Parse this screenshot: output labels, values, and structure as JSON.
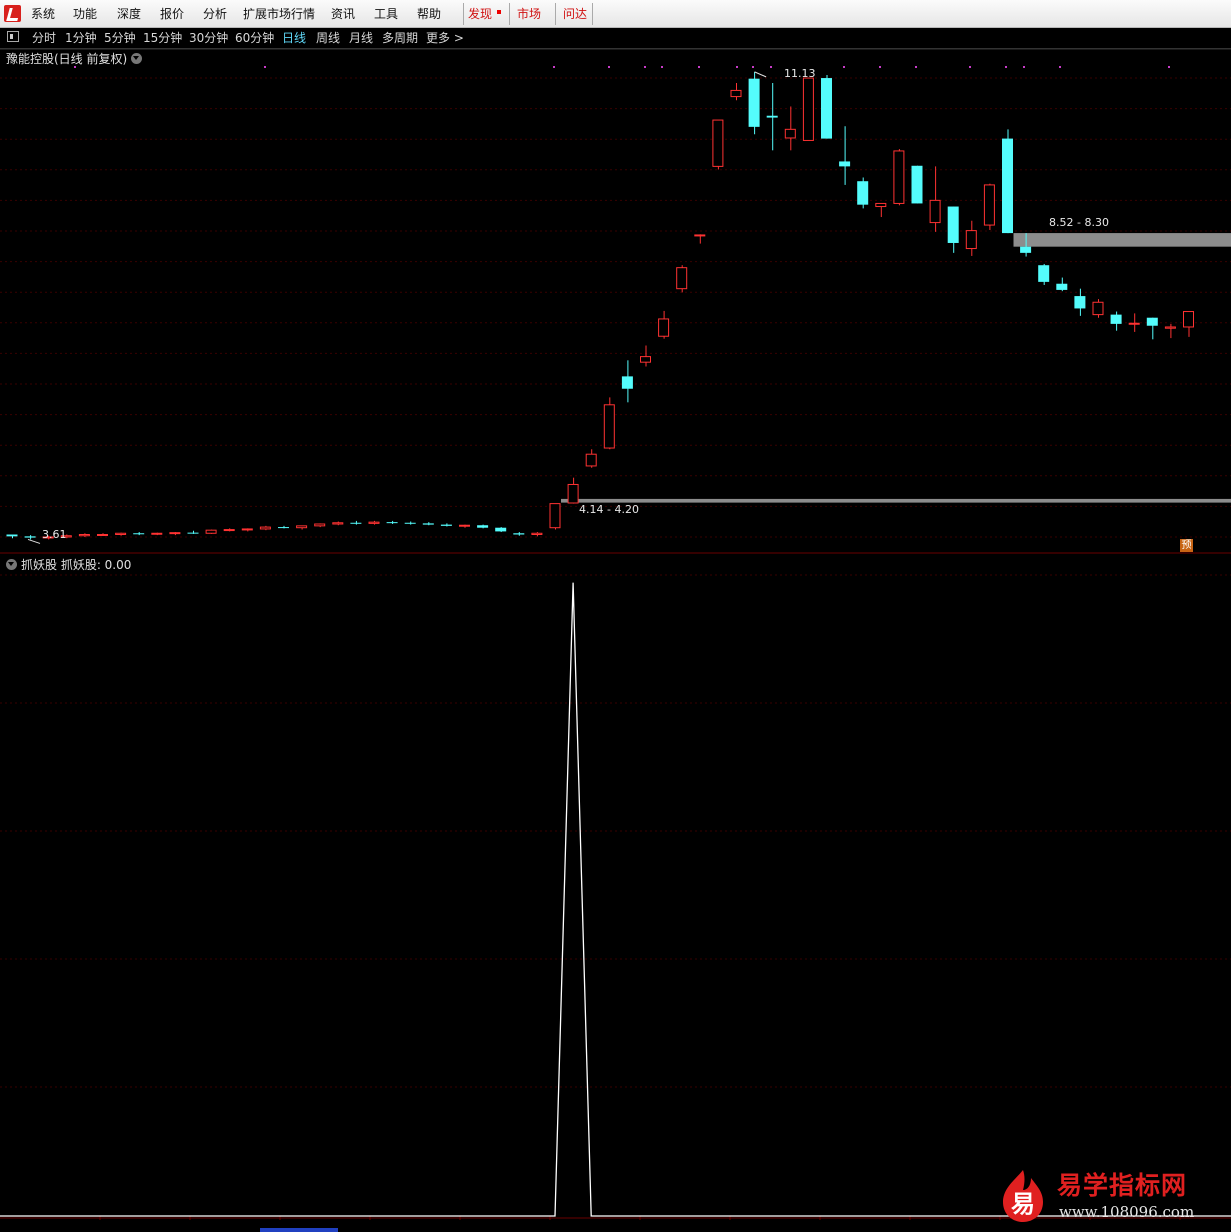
{
  "menu": {
    "items": [
      {
        "label": "系统"
      },
      {
        "label": "功能"
      },
      {
        "label": "深度"
      },
      {
        "label": "报价"
      },
      {
        "label": "分析"
      },
      {
        "label": "扩展市场行情"
      },
      {
        "label": "资讯"
      },
      {
        "label": "工具"
      },
      {
        "label": "帮助"
      }
    ],
    "discover": "发现",
    "market": "市场",
    "wenda": "问达"
  },
  "periods": {
    "items": [
      {
        "label": "分时"
      },
      {
        "label": "1分钟"
      },
      {
        "label": "5分钟"
      },
      {
        "label": "15分钟"
      },
      {
        "label": "30分钟"
      },
      {
        "label": "60分钟"
      },
      {
        "label": "日线"
      },
      {
        "label": "周线"
      },
      {
        "label": "月线"
      },
      {
        "label": "多周期"
      },
      {
        "label": "更多 >"
      }
    ],
    "active": "日线"
  },
  "stock": {
    "title": "豫能控股(日线 前复权)"
  },
  "labels": {
    "high": "11.13",
    "low": "3.61",
    "gap_low": "4.14 - 4.20",
    "gap_high": "8.52 - 8.30",
    "badge": "预"
  },
  "indicator": {
    "title": "抓妖股 抓妖股: 0.00"
  },
  "watermark": {
    "title": "易学指标网",
    "url": "www.108096.com",
    "icon_char": "易"
  },
  "colors": {
    "up": "#ff3232",
    "down": "#54fcfc",
    "grid": "#3a0000",
    "line": "#ffffff",
    "gap": "#8c8c8c"
  },
  "chart_data": {
    "type": "candlestick",
    "candles": [
      [
        3.64,
        3.64,
        3.58,
        3.61
      ],
      [
        3.61,
        3.63,
        3.56,
        3.59
      ],
      [
        3.59,
        3.62,
        3.56,
        3.6
      ],
      [
        3.6,
        3.64,
        3.58,
        3.62
      ],
      [
        3.62,
        3.66,
        3.6,
        3.64
      ],
      [
        3.64,
        3.66,
        3.62,
        3.64
      ],
      [
        3.64,
        3.67,
        3.62,
        3.66
      ],
      [
        3.66,
        3.68,
        3.63,
        3.65
      ],
      [
        3.65,
        3.67,
        3.63,
        3.66
      ],
      [
        3.66,
        3.68,
        3.63,
        3.67
      ],
      [
        3.67,
        3.7,
        3.65,
        3.66
      ],
      [
        3.66,
        3.72,
        3.65,
        3.71
      ],
      [
        3.71,
        3.74,
        3.69,
        3.72
      ],
      [
        3.72,
        3.74,
        3.69,
        3.73
      ],
      [
        3.73,
        3.78,
        3.71,
        3.76
      ],
      [
        3.76,
        3.78,
        3.74,
        3.75
      ],
      [
        3.75,
        3.78,
        3.72,
        3.78
      ],
      [
        3.78,
        3.82,
        3.76,
        3.81
      ],
      [
        3.81,
        3.85,
        3.79,
        3.83
      ],
      [
        3.83,
        3.86,
        3.8,
        3.82
      ],
      [
        3.82,
        3.86,
        3.8,
        3.84
      ],
      [
        3.84,
        3.86,
        3.81,
        3.83
      ],
      [
        3.83,
        3.85,
        3.8,
        3.82
      ],
      [
        3.82,
        3.84,
        3.79,
        3.8
      ],
      [
        3.8,
        3.82,
        3.77,
        3.78
      ],
      [
        3.78,
        3.8,
        3.75,
        3.79
      ],
      [
        3.79,
        3.8,
        3.74,
        3.75
      ],
      [
        3.75,
        3.76,
        3.68,
        3.69
      ],
      [
        3.66,
        3.68,
        3.62,
        3.64
      ],
      [
        3.64,
        3.68,
        3.61,
        3.66
      ],
      [
        3.75,
        4.14,
        3.72,
        4.14
      ],
      [
        4.15,
        4.56,
        4.14,
        4.45
      ],
      [
        4.75,
        5.02,
        4.72,
        4.94
      ],
      [
        5.04,
        5.86,
        5.02,
        5.74
      ],
      [
        6.2,
        6.46,
        5.78,
        6.0
      ],
      [
        6.43,
        6.7,
        6.36,
        6.52
      ],
      [
        6.85,
        7.26,
        6.81,
        7.13
      ],
      [
        7.62,
        8.0,
        7.56,
        7.96
      ],
      [
        8.49,
        8.5,
        8.35,
        8.49
      ],
      [
        9.6,
        10.35,
        9.55,
        10.35
      ],
      [
        10.73,
        10.95,
        10.67,
        10.83
      ],
      [
        11.02,
        11.13,
        10.12,
        10.24
      ],
      [
        10.42,
        10.95,
        9.86,
        10.39
      ],
      [
        10.06,
        10.57,
        9.86,
        10.2
      ],
      [
        10.02,
        11.03,
        10.02,
        11.03
      ],
      [
        11.03,
        11.08,
        10.05,
        10.05
      ],
      [
        9.68,
        10.25,
        9.3,
        9.6
      ],
      [
        9.36,
        9.42,
        8.92,
        8.98
      ],
      [
        8.95,
        9.0,
        8.78,
        9.0
      ],
      [
        9.0,
        9.88,
        8.97,
        9.85
      ],
      [
        9.61,
        9.61,
        9.0,
        9.0
      ],
      [
        8.69,
        9.6,
        8.54,
        9.05
      ],
      [
        8.95,
        8.95,
        8.2,
        8.36
      ],
      [
        8.27,
        8.72,
        8.15,
        8.56
      ],
      [
        8.65,
        9.32,
        8.57,
        9.3
      ],
      [
        10.05,
        10.2,
        8.52,
        8.52
      ],
      [
        8.3,
        8.52,
        8.14,
        8.2
      ],
      [
        8.0,
        8.02,
        7.68,
        7.73
      ],
      [
        7.7,
        7.8,
        7.58,
        7.6
      ],
      [
        7.5,
        7.62,
        7.18,
        7.3
      ],
      [
        7.2,
        7.45,
        7.15,
        7.4
      ],
      [
        7.2,
        7.25,
        6.94,
        7.05
      ],
      [
        7.06,
        7.22,
        6.92,
        7.06
      ],
      [
        7.15,
        7.15,
        6.8,
        7.02
      ],
      [
        6.98,
        7.05,
        6.82,
        7.0
      ],
      [
        7.0,
        7.25,
        6.84,
        7.25
      ]
    ],
    "price_range": [
      3.47,
      11.29
    ],
    "gaps": [
      {
        "from": 4.14,
        "to": 4.2
      },
      {
        "from": 8.3,
        "to": 8.52
      }
    ],
    "indicator": {
      "name": "抓妖股",
      "values": [
        0,
        0,
        0,
        0,
        0,
        0,
        0,
        0,
        0,
        0,
        0,
        0,
        0,
        0,
        0,
        0,
        0,
        0,
        0,
        0,
        0,
        0,
        0,
        0,
        0,
        0,
        0,
        0,
        0,
        0,
        0,
        1,
        0,
        0,
        0,
        0,
        0,
        0,
        0,
        0,
        0,
        0,
        0,
        0,
        0,
        0,
        0,
        0,
        0,
        0,
        0,
        0,
        0,
        0,
        0,
        0,
        0,
        0,
        0,
        0,
        0,
        0,
        0,
        0,
        0,
        0
      ],
      "range": [
        0,
        1.02
      ]
    }
  }
}
